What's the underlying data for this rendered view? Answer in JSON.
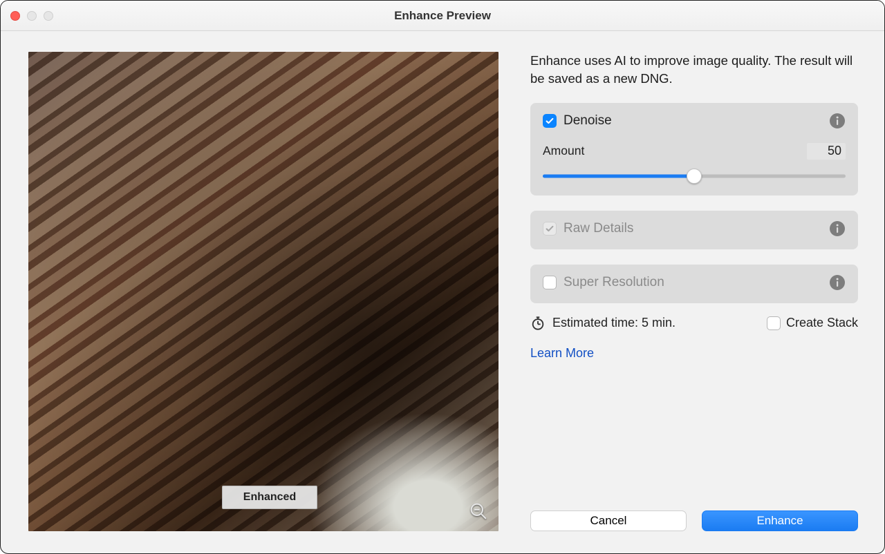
{
  "window": {
    "title": "Enhance Preview"
  },
  "intro": "Enhance uses AI to improve image quality. The result will be saved as a new DNG.",
  "preview": {
    "badge_label": "Enhanced"
  },
  "options": {
    "denoise": {
      "label": "Denoise",
      "checked": true,
      "amount_label": "Amount",
      "amount_value": "50",
      "slider_percent": 50
    },
    "raw_details": {
      "label": "Raw Details",
      "checked": true,
      "disabled": true
    },
    "super_resolution": {
      "label": "Super Resolution",
      "checked": false,
      "disabled": true
    }
  },
  "footer": {
    "estimated_time_label": "Estimated time: 5 min.",
    "create_stack_label": "Create Stack",
    "create_stack_checked": false,
    "learn_more_label": "Learn More"
  },
  "buttons": {
    "cancel": "Cancel",
    "enhance": "Enhance"
  }
}
